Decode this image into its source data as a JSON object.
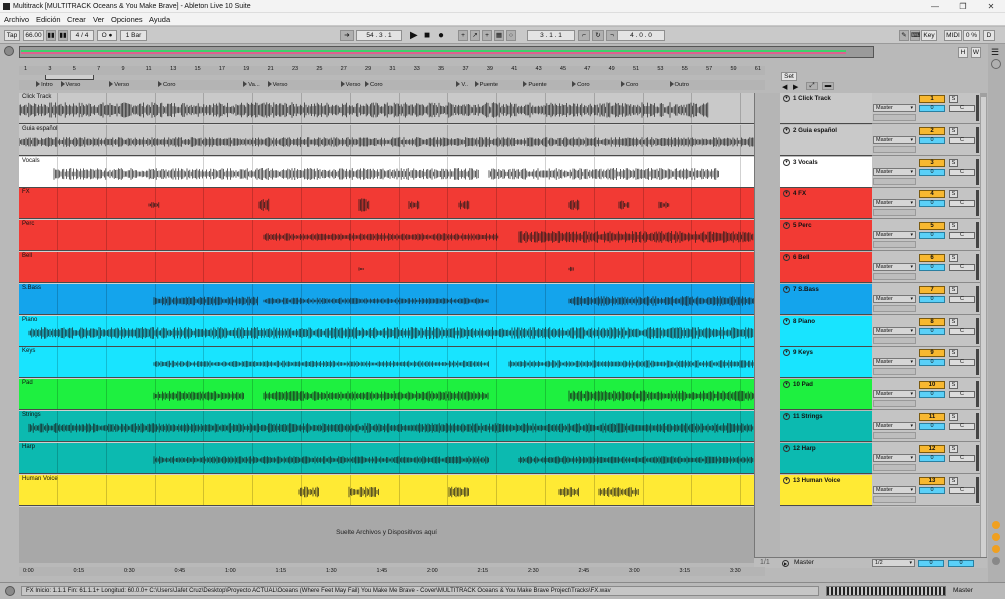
{
  "window": {
    "title": "Multitrack  [MULTITRACK Oceans & You Make Brave] - Ableton Live 10 Suite",
    "minimize": "—",
    "maximize": "❐",
    "close": "✕"
  },
  "menu": [
    "Archivo",
    "Edición",
    "Crear",
    "Ver",
    "Opciones",
    "Ayuda"
  ],
  "transport": {
    "tap": "Tap",
    "tempo": "66.00",
    "signature": "4 / 4",
    "metro": "O ●",
    "quantize": "1 Bar",
    "position": "54 .  3 .  1",
    "loop_start": "3 .  1 .  1",
    "loop_length": "4 .  0 .  0",
    "key": "Key",
    "midi": "MIDI",
    "cpu": "0 %",
    "d": "D",
    "play": "▶",
    "stop": "■",
    "record": "●"
  },
  "overview": {
    "h": "H",
    "w": "W"
  },
  "ruler_bars": [
    "1",
    "3",
    "5",
    "7",
    "9",
    "11",
    "13",
    "15",
    "17",
    "19",
    "21",
    "23",
    "25",
    "27",
    "29",
    "31",
    "33",
    "35",
    "37",
    "39",
    "41",
    "43",
    "45",
    "47",
    "49",
    "51",
    "53",
    "55",
    "57",
    "59",
    "61"
  ],
  "locators": [
    {
      "label": "Intro",
      "bar": 2
    },
    {
      "label": "Verso",
      "bar": 4
    },
    {
      "label": "Verso",
      "bar": 8
    },
    {
      "label": "Coro",
      "bar": 12
    },
    {
      "label": "Va...",
      "bar": 19
    },
    {
      "label": "Verso",
      "bar": 21
    },
    {
      "label": "Verso",
      "bar": 27
    },
    {
      "label": "Coro",
      "bar": 29
    },
    {
      "label": "V..",
      "bar": 36.5
    },
    {
      "label": "Puente",
      "bar": 38
    },
    {
      "label": "Puente",
      "bar": 42
    },
    {
      "label": "Coro",
      "bar": 46
    },
    {
      "label": "Coro",
      "bar": 50
    },
    {
      "label": "Outro",
      "bar": 54
    }
  ],
  "set_button": "Set",
  "tracks": [
    {
      "name": "Click Track",
      "head": "1 Click Track",
      "num": "1",
      "color": "#c9c9c9",
      "wave": "click"
    },
    {
      "name": "Guia español",
      "head": "2 Guia español",
      "num": "2",
      "color": "#c9c9c9",
      "wave": "guide"
    },
    {
      "name": "Vocals",
      "head": "3 Vocals",
      "num": "3",
      "color": "#ffffff",
      "wave": "vocals"
    },
    {
      "name": "FX",
      "head": "4 FX",
      "num": "4",
      "color": "#f23a34",
      "wave": "fx"
    },
    {
      "name": "Perc",
      "head": "5 Perc",
      "num": "5",
      "color": "#f23a34",
      "wave": "perc"
    },
    {
      "name": "Bell",
      "head": "6 Bell",
      "num": "6",
      "color": "#f23a34",
      "wave": "bell"
    },
    {
      "name": "S.Bass",
      "head": "7 S.Bass",
      "num": "7",
      "color": "#14a4ec",
      "wave": "bass"
    },
    {
      "name": "Piano",
      "head": "8 Piano",
      "num": "8",
      "color": "#18e4ff",
      "wave": "piano"
    },
    {
      "name": "Keys",
      "head": "9 Keys",
      "num": "9",
      "color": "#18e4ff",
      "wave": "keys"
    },
    {
      "name": "Pad",
      "head": "10 Pad",
      "num": "10",
      "color": "#1ef040",
      "wave": "pad"
    },
    {
      "name": "Strings",
      "head": "11 Strings",
      "num": "11",
      "color": "#0cbab0",
      "wave": "strings"
    },
    {
      "name": "Harp",
      "head": "12 Harp",
      "num": "12",
      "color": "#0cbab0",
      "wave": "harp"
    },
    {
      "name": "Human Voice",
      "head": "13 Human Voice",
      "num": "13",
      "color": "#ffea34",
      "wave": "voice"
    }
  ],
  "routing": "Master",
  "volume": "0",
  "solo": "S",
  "cue": "C",
  "drop_text": "Suelte Archivos y Dispositivos aquí",
  "master": {
    "label": "Master",
    "routing": "1/2",
    "volume": "0",
    "solo": "0",
    "page": "1/1"
  },
  "time_ticks": [
    "0:00",
    "0:15",
    "0:30",
    "0:45",
    "1:00",
    "1:15",
    "1:30",
    "1:45",
    "2:00",
    "2:15",
    "2:30",
    "2:45",
    "3:00",
    "3:15",
    "3:30"
  ],
  "status": "FX  Inicio: 1.1.1  Fin: 61.1.1+  Longitud: 60.0.0+  C:\\Users\\Jafet Cruz\\Desktop\\Proyecto ACTUAL\\Oceans (Where Feet May Fail)  You Make Me Brave - Cover\\MULTITRACK Oceans & You Make Brave Project\\Tracks\\FX.wav",
  "status_right": "Master"
}
